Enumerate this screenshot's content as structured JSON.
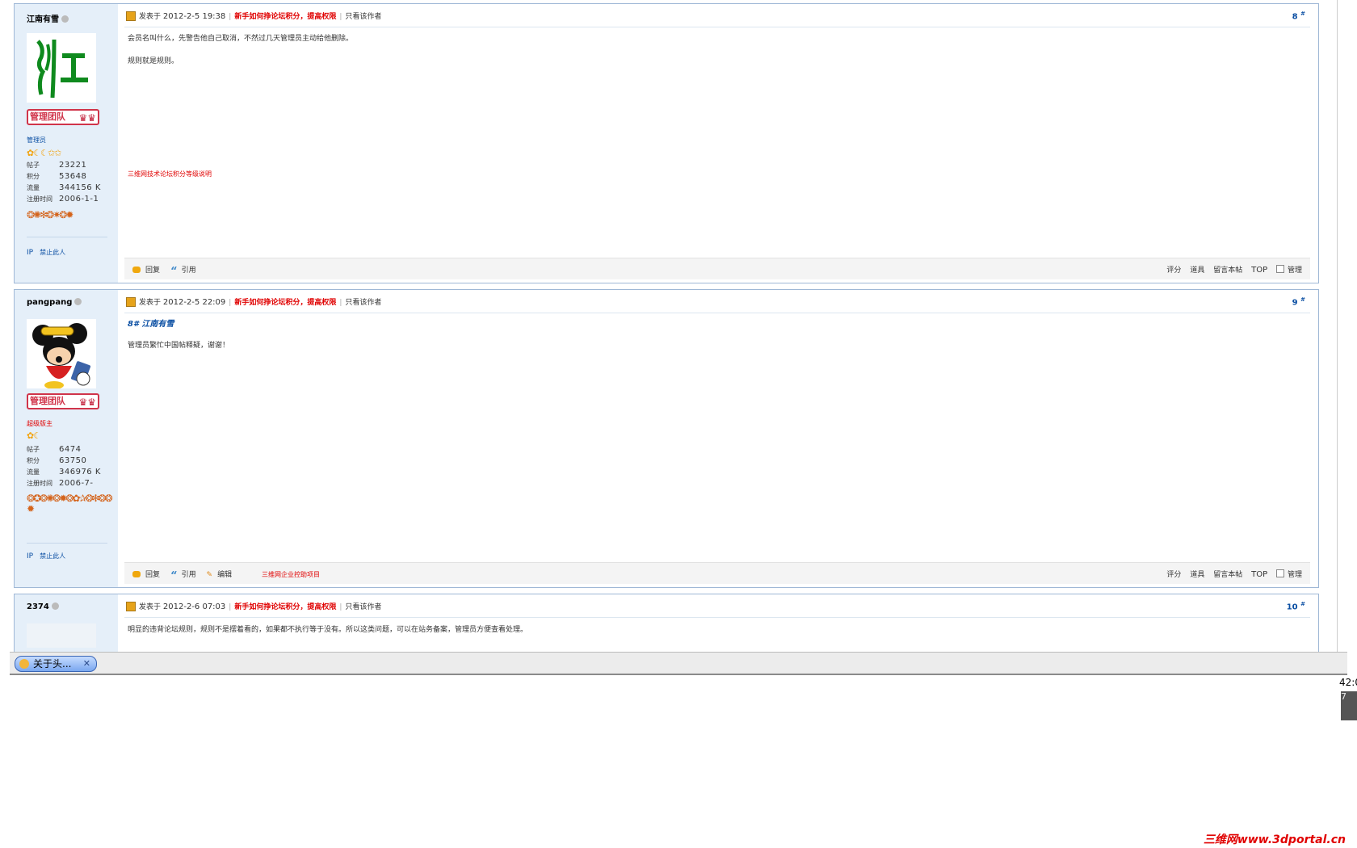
{
  "posts": [
    {
      "username": "江南有雪",
      "badge": "管理团队",
      "rank": "管理员",
      "stars": "✿☾☾✩✩",
      "stats": [
        {
          "k": "帖子",
          "v": "23221"
        },
        {
          "k": "积分",
          "v": "53648"
        },
        {
          "k": "流量",
          "v": "344156 K"
        },
        {
          "k": "注册时间",
          "v": "2006-1-1"
        }
      ],
      "medals": "❂✺✻❂✷❂✹",
      "ip_label": "IP",
      "ban_label": "禁止此人",
      "posted_prefix": "发表于",
      "date": "2012-2-5 19:38",
      "hot_link": "新手如何挣论坛积分，提高权限",
      "author_only": "只看该作者",
      "floor": "8",
      "floor_sup": "#",
      "body": [
        "会员名叫什么，先警告他自己取消，不然过几天管理员主动给他删除。",
        "规则就是规则。"
      ],
      "red_link": "三维网技术论坛积分等级说明",
      "actions_left": [
        "回复",
        "引用"
      ],
      "actions_right": [
        "评分",
        "道具",
        "留言本帖",
        "TOP",
        "管理"
      ]
    },
    {
      "username": "pangpang",
      "badge": "管理团队",
      "rank": "超级版主",
      "stars": "✿☾",
      "stats": [
        {
          "k": "帖子",
          "v": "6474"
        },
        {
          "k": "积分",
          "v": "63750"
        },
        {
          "k": "流量",
          "v": "346976 K"
        },
        {
          "k": "注册时间",
          "v": "2006-7-"
        }
      ],
      "medals": "❂✪❂✺❂✹❂✿✰❂✻❂❂✹",
      "ip_label": "IP",
      "ban_label": "禁止此人",
      "posted_prefix": "发表于",
      "date": "2012-2-5 22:09",
      "hot_link": "新手如何挣论坛积分，提高权限",
      "author_only": "只看该作者",
      "floor": "9",
      "floor_sup": "#",
      "quote_header": "8# 江南有雪",
      "body": [
        "管理员繁忙中国帖释疑，谢谢！"
      ],
      "red_link": "三维网企业控助项目",
      "actions_left": [
        "回复",
        "引用",
        "编辑"
      ],
      "actions_right": [
        "评分",
        "道具",
        "留言本帖",
        "TOP",
        "管理"
      ]
    },
    {
      "username": "2374",
      "posted_prefix": "发表于",
      "date": "2012-2-6 07:03",
      "hot_link": "新手如何挣论坛积分，提高权限",
      "author_only": "只看该作者",
      "floor": "10",
      "floor_sup": "#",
      "body": [
        "明显的违背论坛规则，规则不是摆着看的，如果都不执行等于没有。所以这类问题，可以在站务备案，管理员方便查看处理。"
      ]
    }
  ],
  "taskbar": {
    "tab_label": "关于头...",
    "tab_close": "✕"
  },
  "clock": {
    "top": "42:0",
    "bottom": "7"
  },
  "watermark": "三维网www.3dportal.cn"
}
